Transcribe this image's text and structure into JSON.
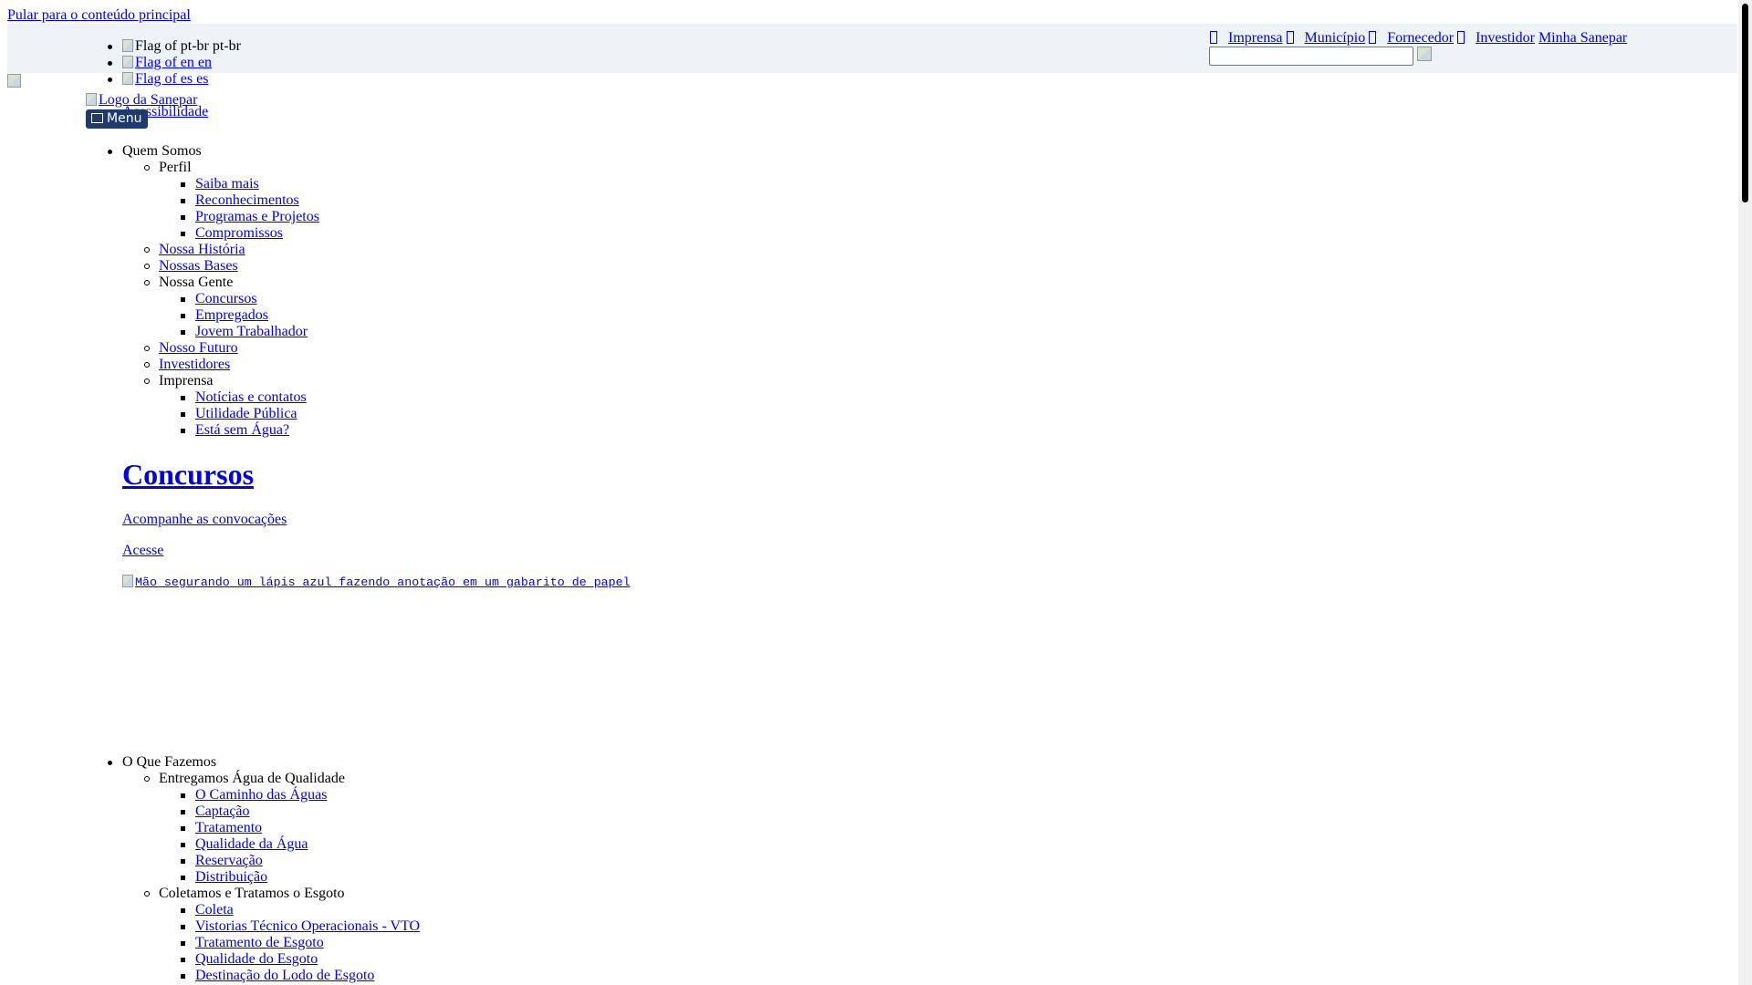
{
  "skip_link": "Pular para o conteúdo principal",
  "languages": [
    {
      "alt": "Flag of pt-br",
      "label": "pt-br",
      "link": false
    },
    {
      "alt": "Flag of en",
      "label": "en",
      "link": true
    },
    {
      "alt": "Flag of es",
      "label": "es",
      "link": true
    }
  ],
  "top_links": [
    "Imprensa",
    "Município",
    "Fornecedor",
    "Investidor",
    "Minha Sanepar"
  ],
  "search": {
    "value": ""
  },
  "logo_alt": "Logo da Sanepar",
  "overlapped_link": "Acessibilidade",
  "menu_button": "Menu",
  "nav": {
    "quem_somos": "Quem Somos",
    "perfil": "Perfil",
    "perfil_items": [
      "Saiba mais",
      "Reconhecimentos",
      "Programas e Projetos",
      "Compromissos"
    ],
    "nossa_historia": "Nossa História",
    "nossas_bases": "Nossas Bases",
    "nossa_gente": "Nossa Gente",
    "nossa_gente_items": [
      "Concursos",
      "Empregados",
      "Jovem Trabalhador"
    ],
    "nosso_futuro": "Nosso Futuro",
    "investidores": "Investidores",
    "imprensa": "Imprensa",
    "imprensa_items": [
      "Notícias e contatos",
      "Utilidade Pública",
      "Está sem Água?"
    ],
    "o_que_fazemos": "O Que Fazemos",
    "agua": "Entregamos Água de Qualidade",
    "agua_items": [
      "O Caminho das Águas",
      "Captação",
      "Tratamento",
      "Qualidade da Água",
      "Reservação",
      "Distribuição"
    ],
    "esgoto": "Coletamos e Tratamos o Esgoto",
    "esgoto_items": [
      "Coleta",
      "Vistorias Técnico Operacionais - VTO",
      "Tratamento de Esgoto",
      "Qualidade do Esgoto",
      "Destinação do Lodo de Esgoto"
    ]
  },
  "hero": {
    "title": "Concursos",
    "subtitle": "Acompanhe as convocações",
    "cta": "Acesse",
    "image_alt": "Mão segurando um lápis azul fazendo anotação em um gabarito de papel"
  }
}
